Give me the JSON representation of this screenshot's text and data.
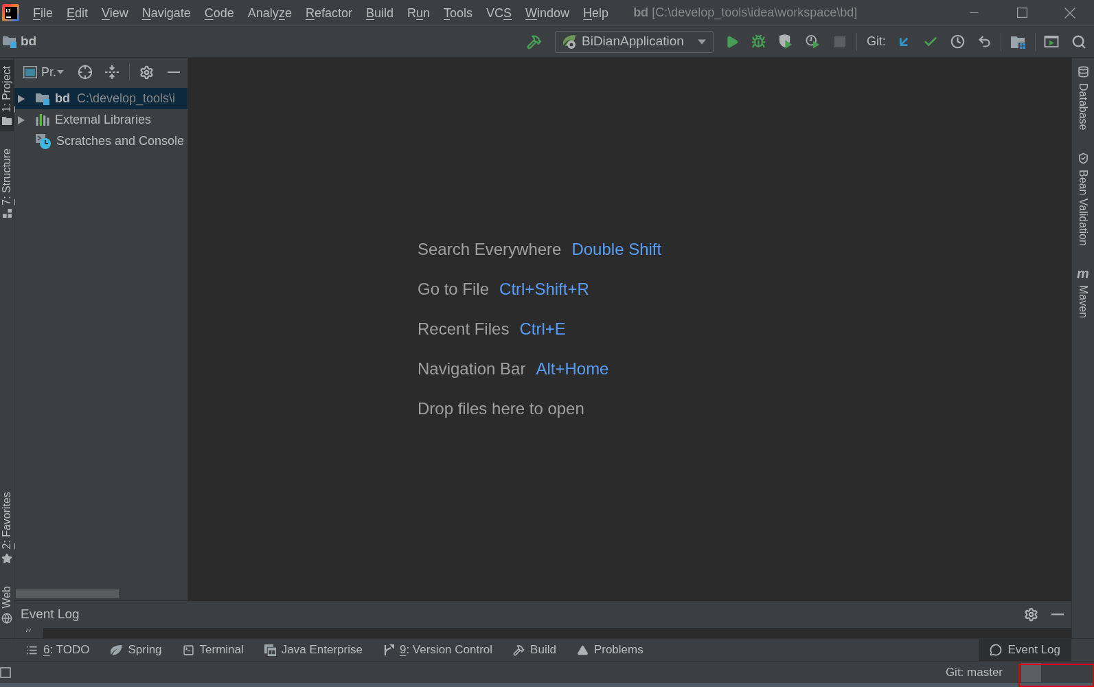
{
  "window": {
    "logo_text": "IJ",
    "title": {
      "project": "bd",
      "path": "[C:\\develop_tools\\idea\\workspace\\bd]"
    }
  },
  "menu_bar": [
    {
      "key": "F",
      "rest": "ile"
    },
    {
      "key": "E",
      "rest": "dit"
    },
    {
      "key": "V",
      "rest": "iew"
    },
    {
      "key": "N",
      "rest": "avigate"
    },
    {
      "key": "C",
      "rest": "ode"
    },
    {
      "lead": "Analy",
      "key": "z",
      "rest": "e"
    },
    {
      "key": "R",
      "rest": "efactor"
    },
    {
      "key": "B",
      "rest": "uild"
    },
    {
      "lead": "R",
      "key": "u",
      "rest": "n"
    },
    {
      "key": "T",
      "rest": "ools"
    },
    {
      "lead": "VC",
      "key": "S"
    },
    {
      "key": "W",
      "rest": "indow"
    },
    {
      "key": "H",
      "rest": "elp"
    }
  ],
  "navigation_bar": {
    "project": "bd"
  },
  "toolbar": {
    "run_configuration": "BiDianApplication",
    "git_label": "Git:"
  },
  "left_tool_tabs": [
    {
      "key": "1",
      "rest": ": Project",
      "selected": true
    },
    {
      "key": "7",
      "rest": ": Structure",
      "selected": false
    },
    {
      "key": "2",
      "rest": ": Favorites",
      "selected": false
    },
    {
      "label": "Web",
      "selected": false
    }
  ],
  "project_panel": {
    "view_label": "Pr.",
    "tree": [
      {
        "kind": "module",
        "name": "bd",
        "path": "C:\\develop_tools\\i",
        "selected": true,
        "expanded": false
      },
      {
        "kind": "libraries",
        "name": "External Libraries",
        "selected": false,
        "expanded": false
      },
      {
        "kind": "scratches",
        "name": "Scratches and Console",
        "selected": false
      }
    ]
  },
  "editor": {
    "hints": [
      {
        "label": "Search Everywhere",
        "shortcut": "Double Shift"
      },
      {
        "label": "Go to File",
        "shortcut": "Ctrl+Shift+R"
      },
      {
        "label": "Recent Files",
        "shortcut": "Ctrl+E"
      },
      {
        "label": "Navigation Bar",
        "shortcut": "Alt+Home"
      },
      {
        "label": "Drop files here to open"
      }
    ]
  },
  "right_tool_tabs": [
    {
      "label": "Database",
      "selected": false
    },
    {
      "label": "Bean Validation",
      "selected": false
    },
    {
      "icon_text": "m",
      "label": "Maven",
      "selected": false
    }
  ],
  "event_log_panel": {
    "title": "Event Log"
  },
  "bottom_tool_tabs": [
    {
      "key": "6",
      "rest": ": TODO",
      "selected": false
    },
    {
      "label": "Spring",
      "selected": false
    },
    {
      "label": "Terminal",
      "selected": false
    },
    {
      "label": "Java Enterprise",
      "selected": false
    },
    {
      "key": "9",
      "rest": ": Version Control",
      "selected": false
    },
    {
      "label": "Build",
      "selected": false
    },
    {
      "label": "Problems",
      "selected": false
    }
  ],
  "bottom_right_tabs": [
    {
      "label": "Event Log",
      "selected": true
    }
  ],
  "status_bar": {
    "vcs_branch": "Git: master"
  }
}
